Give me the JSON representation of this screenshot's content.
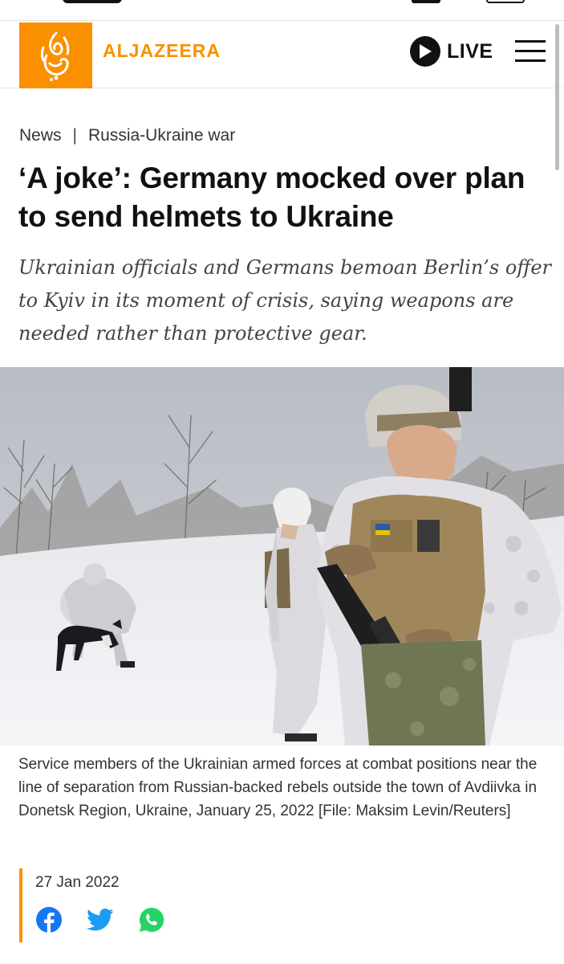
{
  "brand": {
    "name": "ALJAZEERA",
    "accent_color": "#fa9000"
  },
  "header": {
    "live_label": "LIVE",
    "live_icon": "play-icon",
    "menu_icon": "hamburger-menu-icon"
  },
  "breadcrumb": {
    "items": [
      "News",
      "Russia-Ukraine war"
    ],
    "separator": "|"
  },
  "article": {
    "headline": "‘A joke’: Germany mocked over plan to send helmets to Ukraine",
    "standfirst": "Ukrainian officials and Germans bemoan Berlin’s offer to Kyiv in its moment of crisis, saying weapons are needed rather than protective gear.",
    "caption": "Service members of the Ukrainian armed forces at combat positions near the line of separation from Russian-backed rebels outside the town of Avdiivka in Donetsk Region, Ukraine, January 25, 2022 [File: Maksim Levin/Reuters]",
    "date": "27 Jan 2022"
  },
  "share": {
    "icons": [
      "facebook-icon",
      "twitter-icon",
      "whatsapp-icon"
    ],
    "colors": {
      "facebook": "#1877f2",
      "twitter": "#1d9bf0",
      "whatsapp": "#25d366"
    }
  }
}
